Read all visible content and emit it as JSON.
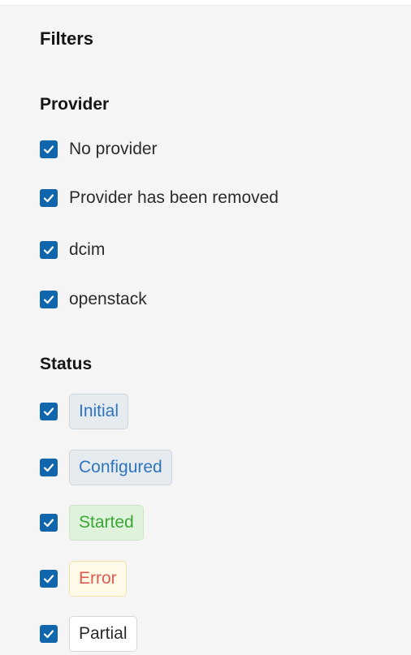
{
  "title": "Filters",
  "provider": {
    "heading": "Provider",
    "options": [
      {
        "label": "No provider",
        "checked": true
      },
      {
        "label": "Provider has been removed",
        "checked": true
      },
      {
        "label": "dcim",
        "checked": true
      },
      {
        "label": "openstack",
        "checked": true
      }
    ]
  },
  "status": {
    "heading": "Status",
    "options": [
      {
        "label": "Initial",
        "checked": true,
        "color": "#2f74bd"
      },
      {
        "label": "Configured",
        "checked": true,
        "color": "#2f74bd"
      },
      {
        "label": "Started",
        "checked": true,
        "color": "#3aa735"
      },
      {
        "label": "Error",
        "checked": true,
        "color": "#e05a4f"
      },
      {
        "label": "Partial",
        "checked": true,
        "color": "#2b2b2b"
      }
    ]
  },
  "icons": {
    "checkbox": "check-icon"
  },
  "colors": {
    "checkbox_fill": "#0f66ac"
  }
}
